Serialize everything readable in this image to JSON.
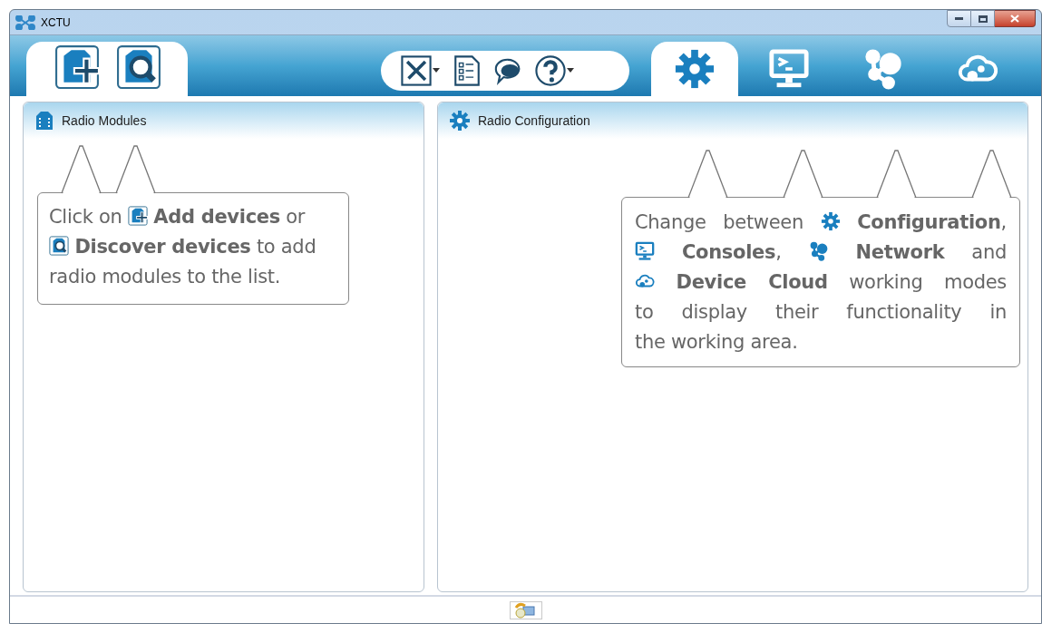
{
  "window": {
    "title": "XCTU"
  },
  "device_buttons": [
    {
      "kind": "add"
    },
    {
      "kind": "discover"
    }
  ],
  "tools": [
    {
      "kind": "tools"
    },
    {
      "kind": "caret"
    },
    {
      "kind": "list"
    },
    {
      "kind": "chat"
    },
    {
      "kind": "help"
    },
    {
      "kind": "caret"
    }
  ],
  "modes": [
    {
      "kind": "gear",
      "selected": true
    },
    {
      "kind": "console",
      "selected": false
    },
    {
      "kind": "network",
      "selected": false
    },
    {
      "kind": "cloud",
      "selected": false
    }
  ],
  "left_panel": {
    "title": "Radio Modules",
    "tip": [
      [
        {
          "kind": "text",
          "text": "Click on "
        },
        {
          "kind": "add"
        },
        {
          "kind": "text",
          "text": " **Add devices** or"
        }
      ],
      [
        {
          "kind": "discover"
        },
        {
          "kind": "text",
          "text": " **Discover devices** to add"
        }
      ],
      [
        {
          "kind": "text",
          "text": "radio modules to the list."
        }
      ]
    ]
  },
  "right_panel": {
    "title": "Radio Configuration",
    "tip": [
      [
        {
          "kind": "text",
          "text": "Change between "
        },
        {
          "kind": "gear"
        },
        {
          "kind": "text",
          "text": " **Configuration**,"
        }
      ],
      [
        {
          "kind": "console"
        },
        {
          "kind": "text",
          "text": " **Consoles**, "
        },
        {
          "kind": "network"
        },
        {
          "kind": "text",
          "text": " **Network** and"
        }
      ],
      [
        {
          "kind": "cloud"
        },
        {
          "kind": "text",
          "text": " **Device Cloud** working modes"
        }
      ],
      [
        {
          "kind": "text",
          "text": "to display their functionality in"
        }
      ],
      [
        {
          "kind": "text",
          "text": "the working area."
        }
      ]
    ]
  }
}
